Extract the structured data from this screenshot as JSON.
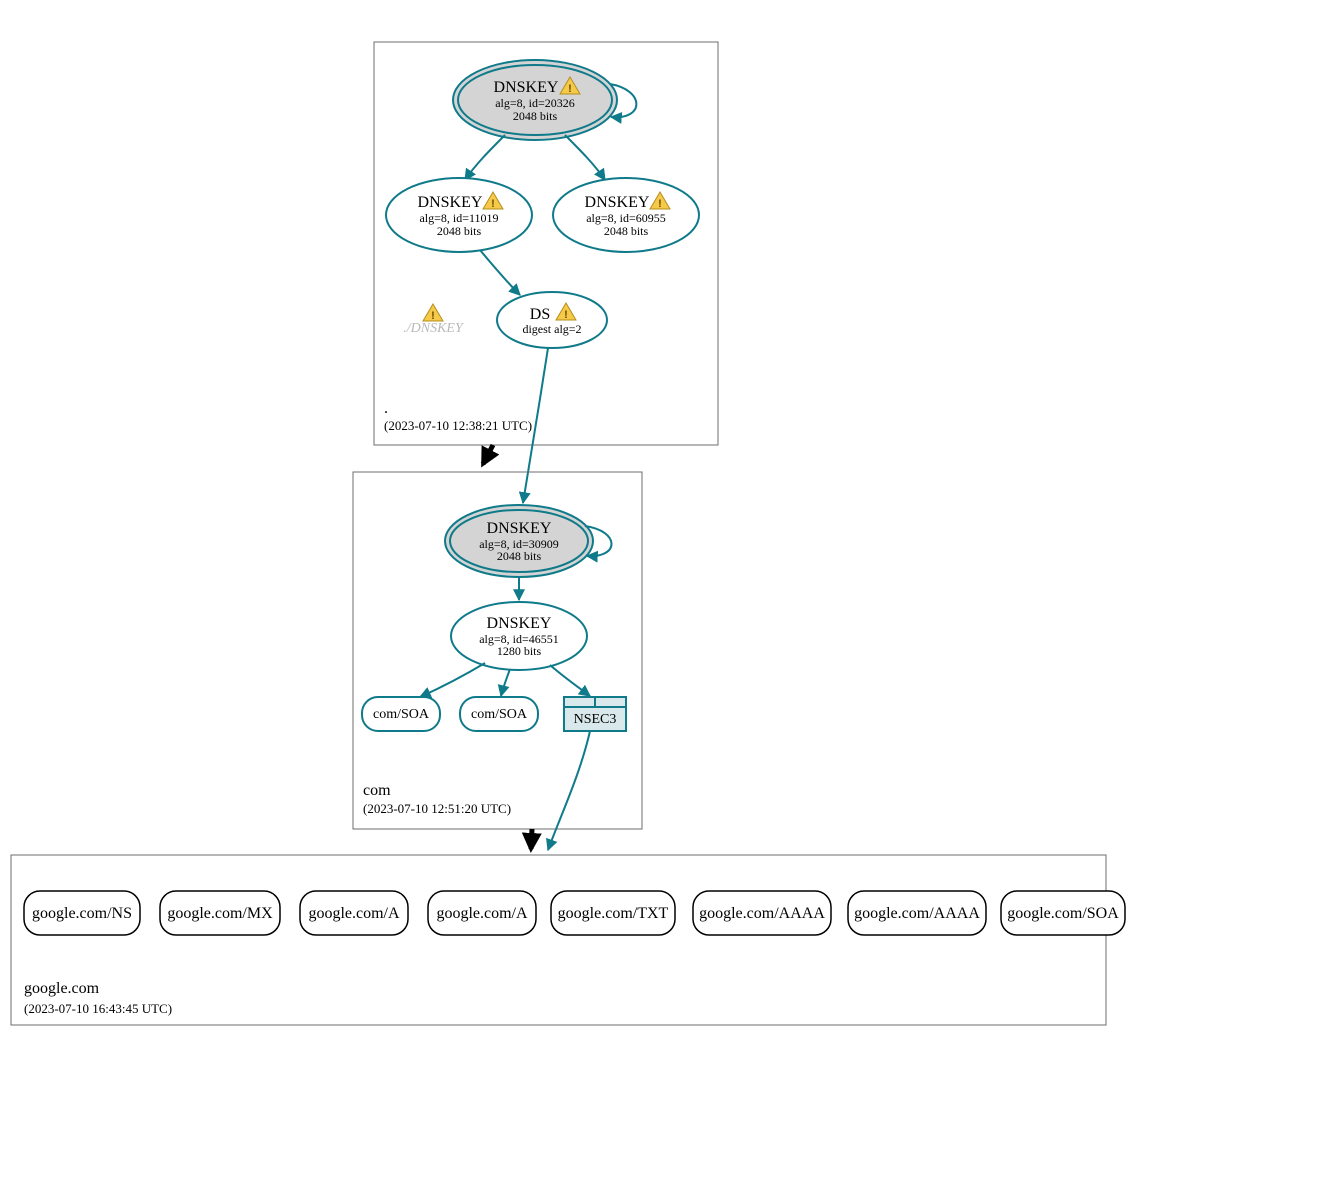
{
  "colors": {
    "teal": "#0f7a8a",
    "node_fill_grey": "#d4d4d4",
    "nsec3_fill": "#d9e8ea"
  },
  "zones": {
    "root": {
      "name_line": ".",
      "timestamp": "(2023-07-10 12:38:21 UTC)",
      "nodes": {
        "ksk": {
          "title": "DNSKEY",
          "line2": "alg=8, id=20326",
          "line3": "2048 bits",
          "warning": true
        },
        "zsk_left": {
          "title": "DNSKEY",
          "line2": "alg=8, id=11019",
          "line3": "2048 bits",
          "warning": true
        },
        "zsk_right": {
          "title": "DNSKEY",
          "line2": "alg=8, id=60955",
          "line3": "2048 bits",
          "warning": true
        },
        "ds": {
          "title": "DS",
          "line2": "digest alg=2",
          "warning": true
        },
        "ghost": {
          "label": "./DNSKEY",
          "warning": true
        }
      }
    },
    "com": {
      "name_line": "com",
      "timestamp": "(2023-07-10 12:51:20 UTC)",
      "nodes": {
        "ksk": {
          "title": "DNSKEY",
          "line2": "alg=8, id=30909",
          "line3": "2048 bits"
        },
        "zsk": {
          "title": "DNSKEY",
          "line2": "alg=8, id=46551",
          "line3": "1280 bits"
        },
        "soa1": "com/SOA",
        "soa2": "com/SOA",
        "nsec3": "NSEC3"
      }
    },
    "google": {
      "name_line": "google.com",
      "timestamp": "(2023-07-10 16:43:45 UTC)",
      "records": [
        "google.com/NS",
        "google.com/MX",
        "google.com/A",
        "google.com/A",
        "google.com/TXT",
        "google.com/AAAA",
        "google.com/AAAA",
        "google.com/SOA"
      ]
    }
  }
}
